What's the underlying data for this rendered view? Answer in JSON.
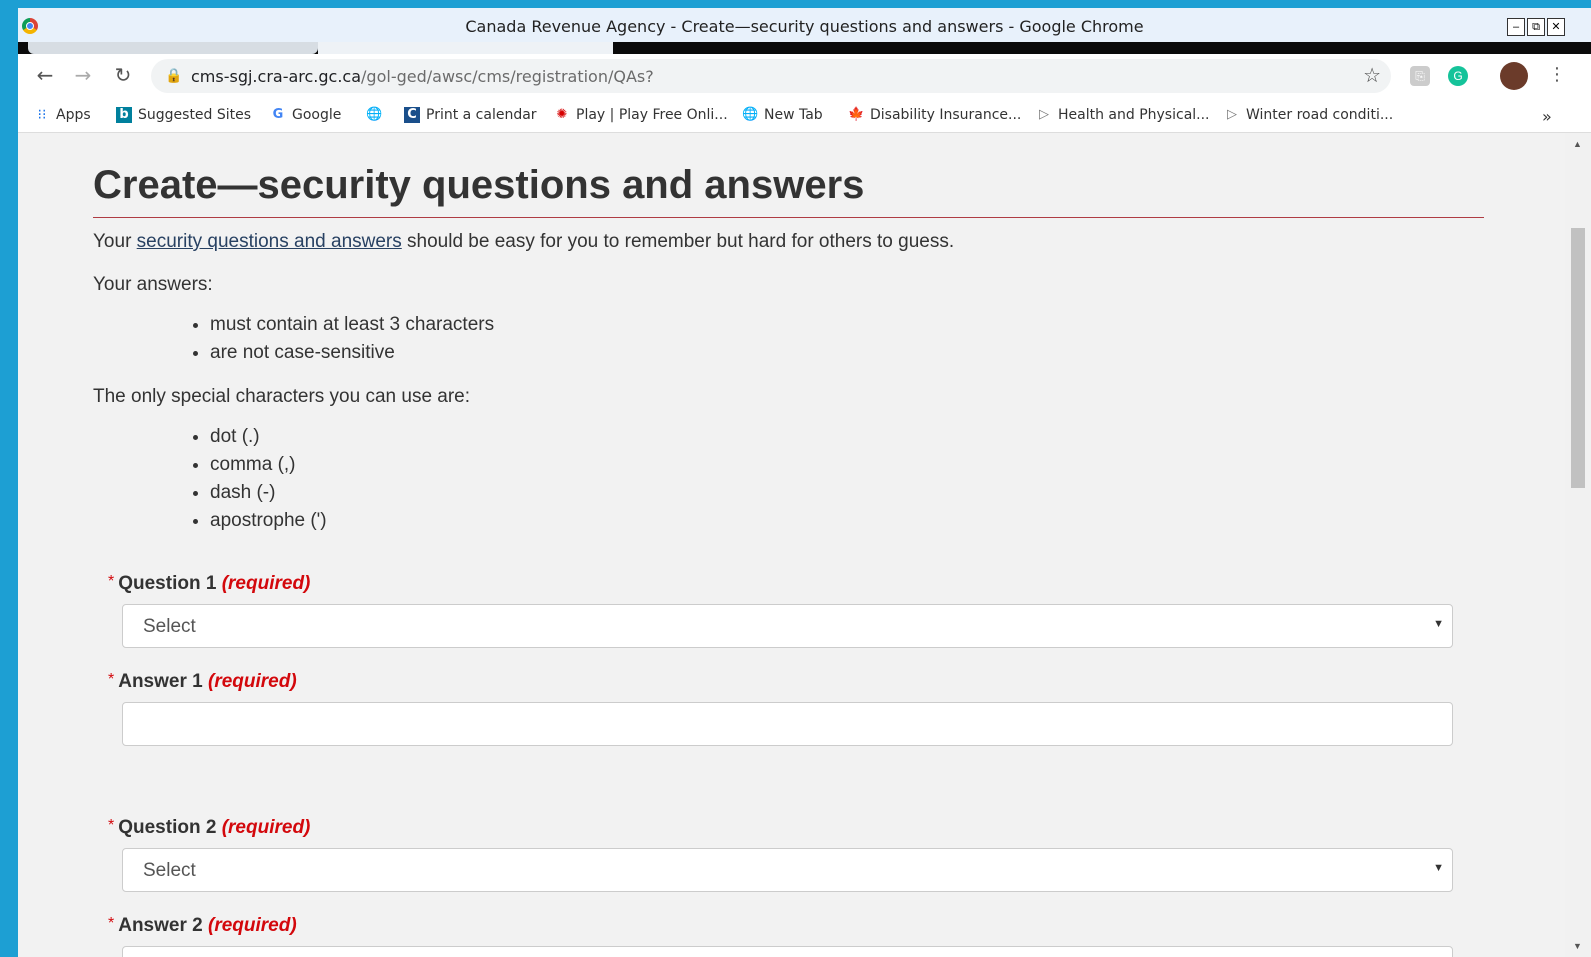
{
  "window": {
    "title": "Canada Revenue Agency - Create—security questions and answers - Google Chrome",
    "controls": [
      "–",
      "⧉",
      "✕"
    ]
  },
  "toolbar": {
    "url_domain": "cms-sgj.cra-arc.gc.ca",
    "url_path": "/gol-ged/awsc/cms/registration/QAs?"
  },
  "bookmarks": [
    {
      "label": "Apps",
      "icon": "apps-grid-icon"
    },
    {
      "label": "Suggested Sites",
      "icon": "bing-icon"
    },
    {
      "label": "Google",
      "icon": "google-g-icon"
    },
    {
      "label": "",
      "icon": "globe-icon"
    },
    {
      "label": "Print a calendar",
      "icon": "calendar-icon"
    },
    {
      "label": "Play | Play Free Onli...",
      "icon": "cbc-icon"
    },
    {
      "label": "New Tab",
      "icon": "globe-icon"
    },
    {
      "label": "Disability Insurance...",
      "icon": "maple-leaf-icon"
    },
    {
      "label": "Health and Physical...",
      "icon": "play-icon"
    },
    {
      "label": "Winter road conditi...",
      "icon": "play-icon"
    }
  ],
  "bookmarks_overflow": "»",
  "page": {
    "title": "Create—security questions and answers",
    "intro_prefix": "Your ",
    "intro_link": "security questions and answers",
    "intro_suffix": " should be easy for you to remember but hard for others to guess.",
    "answers_heading": "Your answers:",
    "answer_rules": [
      "must contain at least 3 characters",
      "are not case-sensitive"
    ],
    "special_heading": "The only special characters you can use are:",
    "special_chars": [
      "dot (.)",
      "comma (,)",
      "dash (-)",
      "apostrophe (')"
    ]
  },
  "form": {
    "required_marker": "*",
    "required_text": "(required)",
    "question1_label": "Question 1",
    "question1_value": "Select",
    "answer1_label": "Answer 1",
    "answer1_value": "",
    "question2_label": "Question 2",
    "question2_value": "Select",
    "answer2_label": "Answer 2"
  }
}
